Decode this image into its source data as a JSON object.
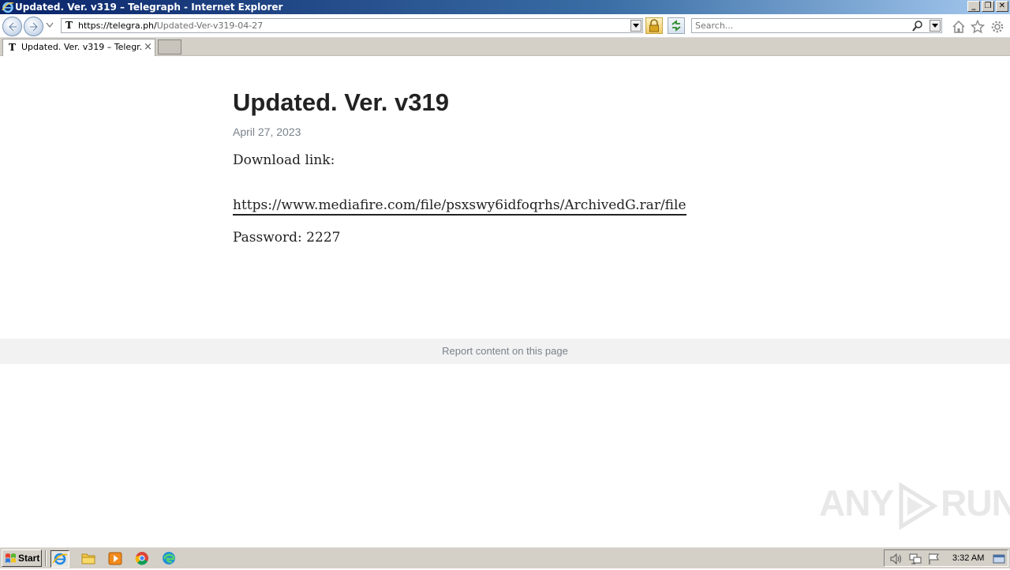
{
  "window": {
    "title": "Updated. Ver. v319 – Telegraph - Internet Explorer",
    "controls": {
      "minimize": "_",
      "restore": "❐",
      "close": "✕"
    }
  },
  "address_bar": {
    "site_glyph": "T",
    "url_host": "https://telegra.ph/",
    "url_path": "Updated-Ver-v319-04-27"
  },
  "search": {
    "placeholder": "Search..."
  },
  "tabs": [
    {
      "glyph": "T",
      "label": "Updated. Ver. v319 – Telegr...",
      "close": "×",
      "active": true
    }
  ],
  "article": {
    "title": "Updated. Ver. v319",
    "date": "April 27, 2023",
    "intro": "Download link:",
    "link": "https://www.mediafire.com/file/psxswy6idfoqrhs/ArchivedG.rar/file",
    "password": "Password: 2227"
  },
  "footer": {
    "report": "Report content on this page"
  },
  "watermark": {
    "left": "ANY",
    "right": "RUN"
  },
  "taskbar": {
    "start_label": "Start",
    "quick_launch": [
      "internet-explorer",
      "file-explorer",
      "media-player",
      "chrome",
      "edge"
    ],
    "clock": "3:32 AM"
  },
  "colors": {
    "title_gradient_start": "#0a246a",
    "text": "#222222",
    "muted": "#79828b",
    "taskbar": "#d4d0c8"
  }
}
